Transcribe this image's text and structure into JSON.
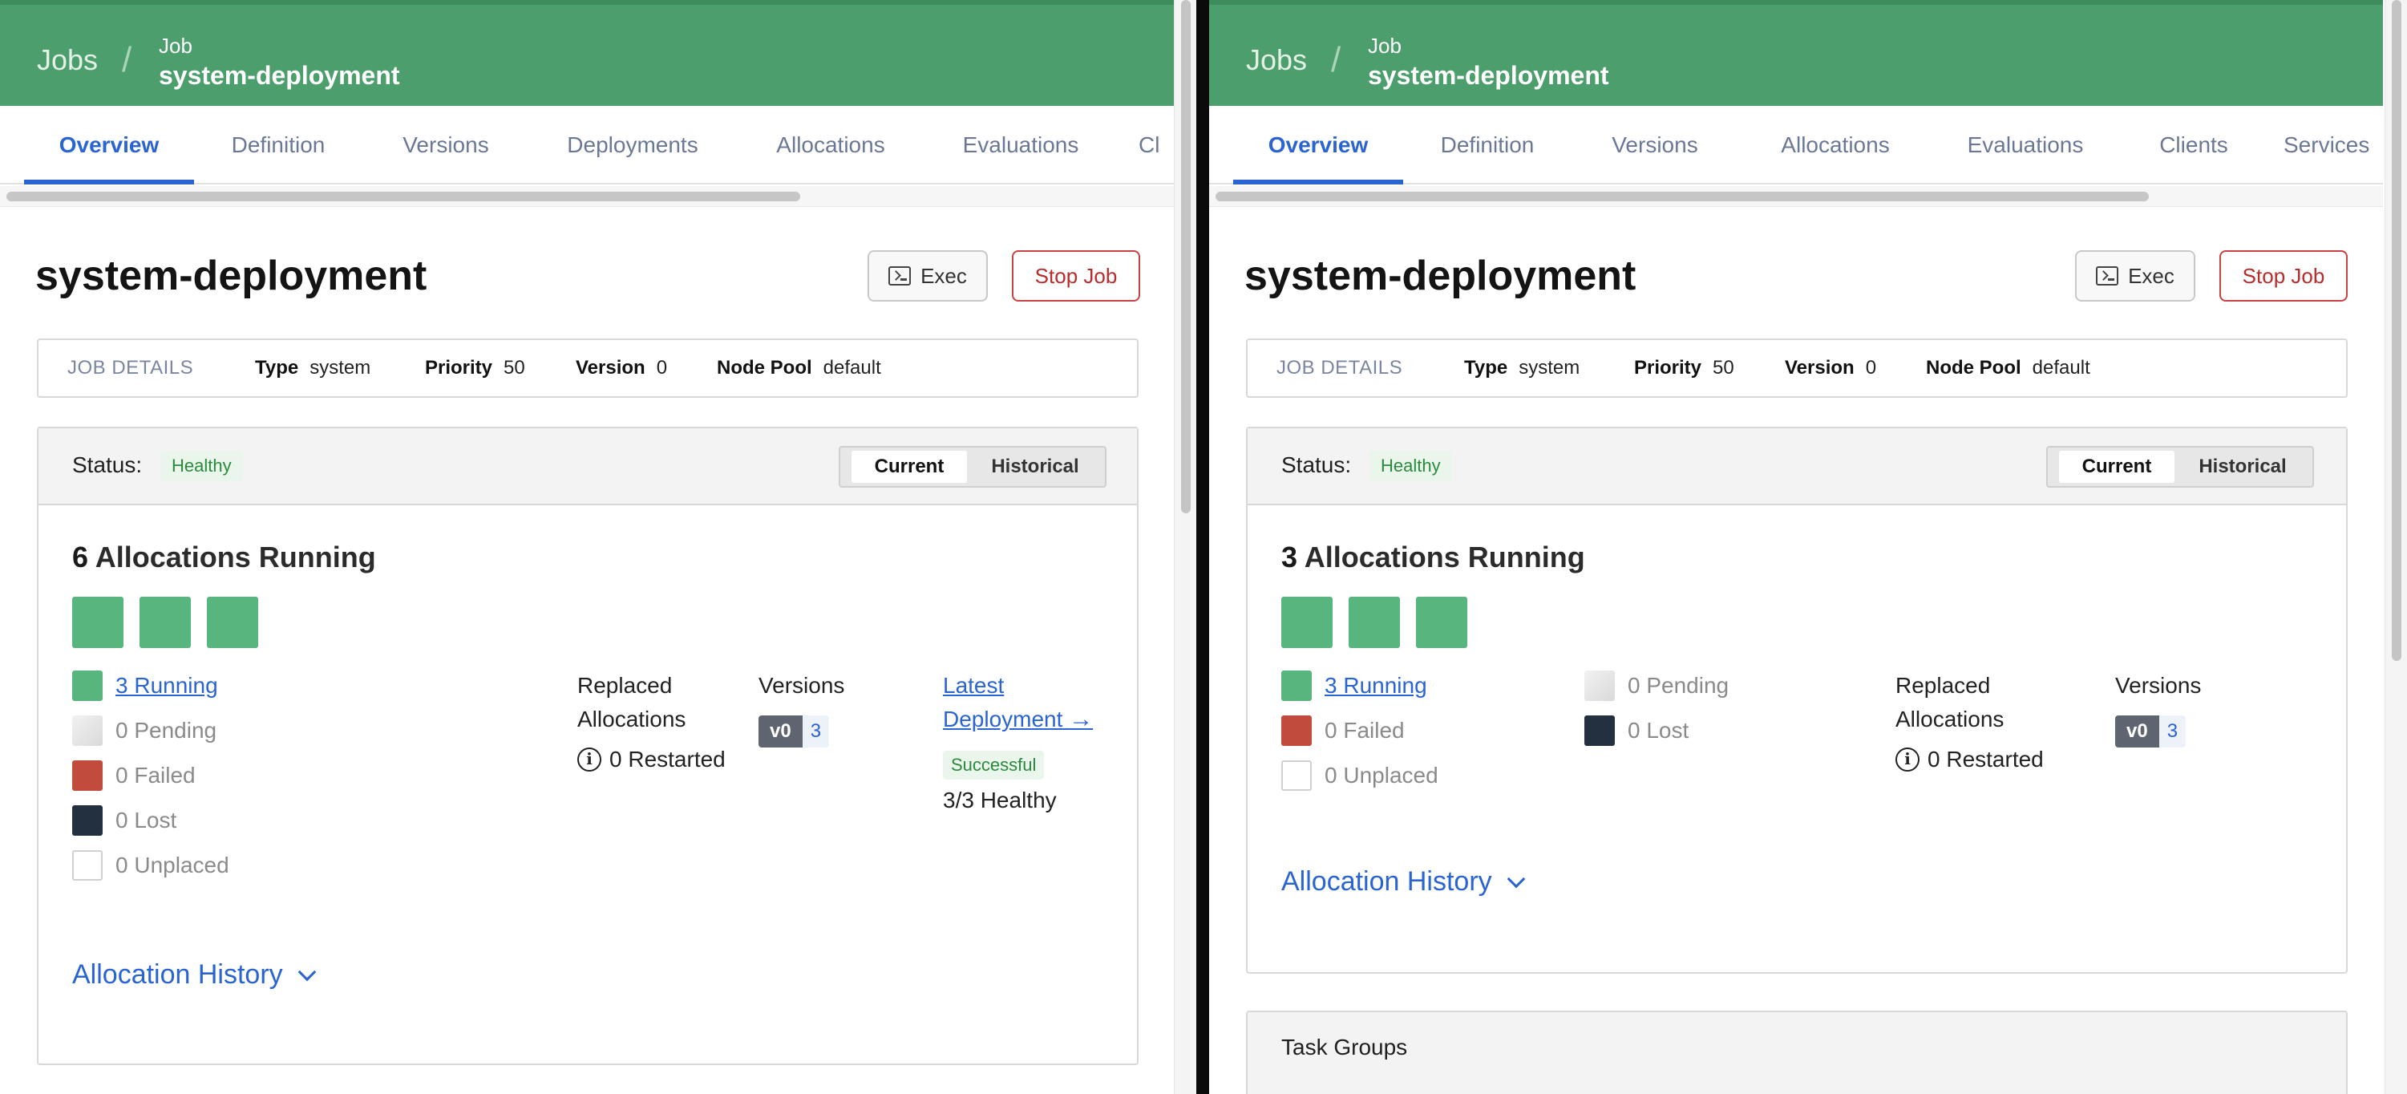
{
  "breadcrumb": {
    "root": "Jobs",
    "sep": "/",
    "sub": "Job",
    "name": "system-deployment"
  },
  "tabs_left": [
    "Overview",
    "Definition",
    "Versions",
    "Deployments",
    "Allocations",
    "Evaluations",
    "Cl"
  ],
  "tabs_right": [
    "Overview",
    "Definition",
    "Versions",
    "Allocations",
    "Evaluations",
    "Clients",
    "Services"
  ],
  "title": "system-deployment",
  "actions": {
    "exec": "Exec",
    "stop": "Stop Job"
  },
  "details": {
    "heading": "JOB DETAILS",
    "type_label": "Type",
    "type": "system",
    "priority_label": "Priority",
    "priority": "50",
    "version_label": "Version",
    "version": "0",
    "pool_label": "Node Pool",
    "pool": "default"
  },
  "status": {
    "label": "Status:",
    "value": "Healthy",
    "current": "Current",
    "historical": "Historical"
  },
  "left": {
    "alloc_count": "6",
    "running": "3 Running",
    "pending": "0 Pending",
    "failed": "0 Failed",
    "lost": "0 Lost",
    "unplaced": "0 Unplaced"
  },
  "right": {
    "alloc_count": "3",
    "running": "3 Running",
    "pending": "0 Pending",
    "failed": "0 Failed",
    "lost": "0 Lost",
    "unplaced": "0 Unplaced"
  },
  "alloc_suffix": "Allocations Running",
  "replaced": {
    "line1": "Replaced",
    "line2": "Allocations",
    "restarted": "0 Restarted"
  },
  "versions": {
    "label": "Versions",
    "tag": "v0",
    "count": "3"
  },
  "deployment": {
    "line1": "Latest",
    "line2": "Deployment",
    "status": "Successful",
    "healthy": "3/3 Healthy"
  },
  "allocation_history": "Allocation History",
  "task_groups": "Task Groups",
  "colors": {
    "header": "#4d9e6d",
    "accent": "#2a64d2",
    "running": "#58b57e",
    "failed": "#c14b3d",
    "lost": "#23303f"
  }
}
